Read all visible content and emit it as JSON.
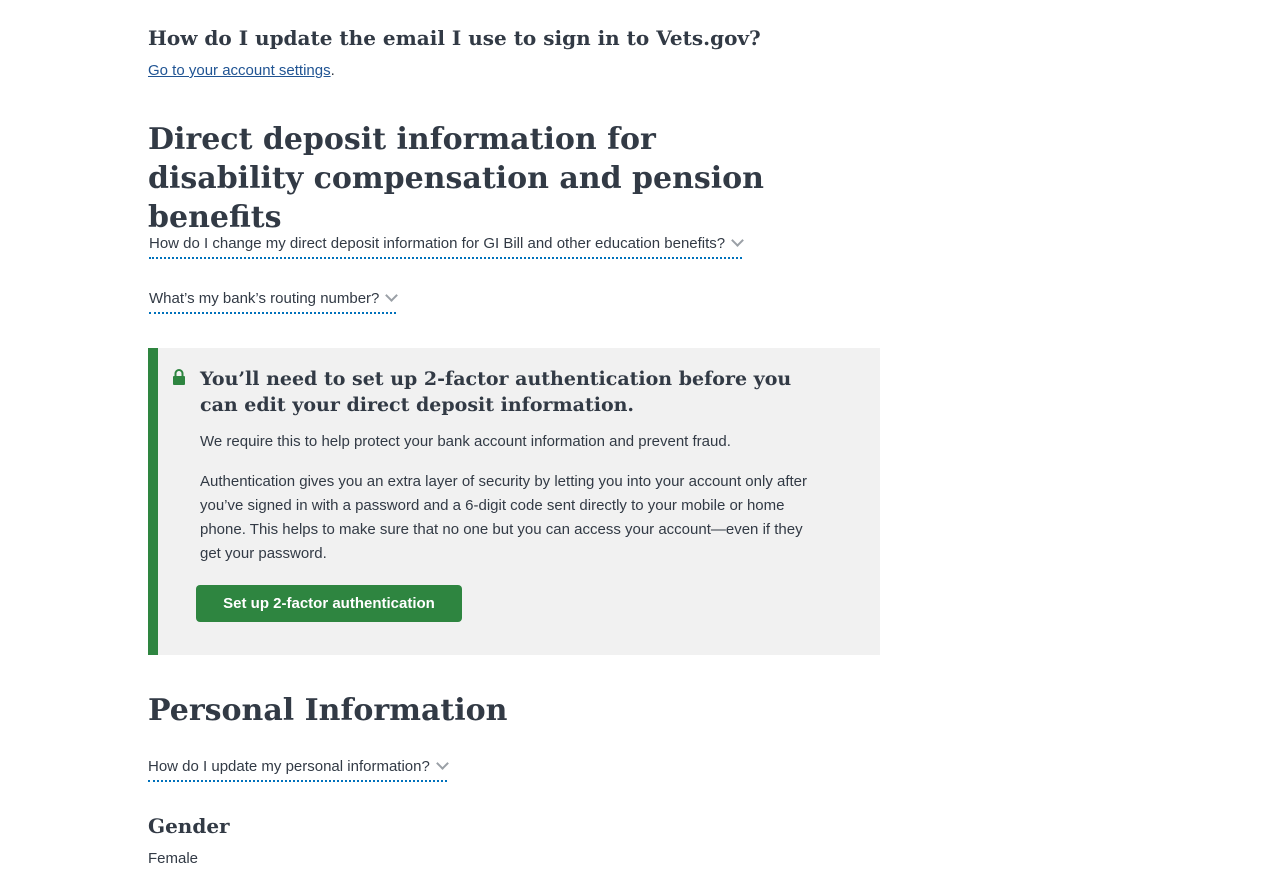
{
  "email_help": {
    "heading": "How do I update the email I use to sign in to Vets.gov?",
    "link_text": "Go to your account settings",
    "suffix": "."
  },
  "direct_deposit": {
    "title": "Direct deposit information for disability compensation and pension benefits",
    "expanders": [
      "How do I change my direct deposit information for GI Bill and other education benefits?",
      "What’s my bank’s routing number?"
    ],
    "alert": {
      "icon": "lock-icon",
      "accent_color": "#2e8540",
      "background": "#f1f1f1",
      "heading": "You’ll need to set up 2-factor authentication before you can edit your direct deposit information.",
      "p1": "We require this to help protect your bank account information and prevent fraud.",
      "p2": "Authentication  gives you an extra layer of security by letting you into your account only after you’ve signed in with a password and a 6-digit code sent directly to your mobile or home phone. This helps to make sure that no one but you can access your account—even if they get your password.",
      "button": "Set up 2-factor authentication"
    }
  },
  "personal_info": {
    "title": "Personal Information",
    "expander": "How do I update my personal information?",
    "gender_label": "Gender",
    "gender_value": "Female"
  }
}
